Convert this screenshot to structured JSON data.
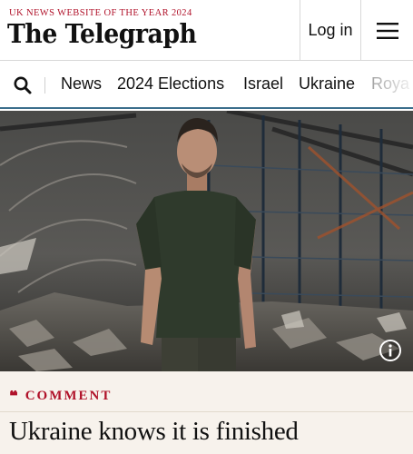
{
  "header": {
    "tagline": "UK NEWS WEBSITE OF THE YEAR 2024",
    "logo": "The Telegraph",
    "login_label": "Log in"
  },
  "nav": {
    "items": [
      "News",
      "2024 Elections",
      "Israel",
      "Ukraine",
      "Roya"
    ]
  },
  "article": {
    "kicker": "COMMENT",
    "quote_glyph": "“",
    "headline": "Ukraine knows it is finished"
  },
  "colors": {
    "brand_red": "#b0122a",
    "nav_accent": "#3b6e8c",
    "band_bg": "#f7f2ec"
  },
  "icons": {
    "search": "search-icon",
    "menu": "hamburger-menu-icon",
    "info": "info-icon"
  }
}
